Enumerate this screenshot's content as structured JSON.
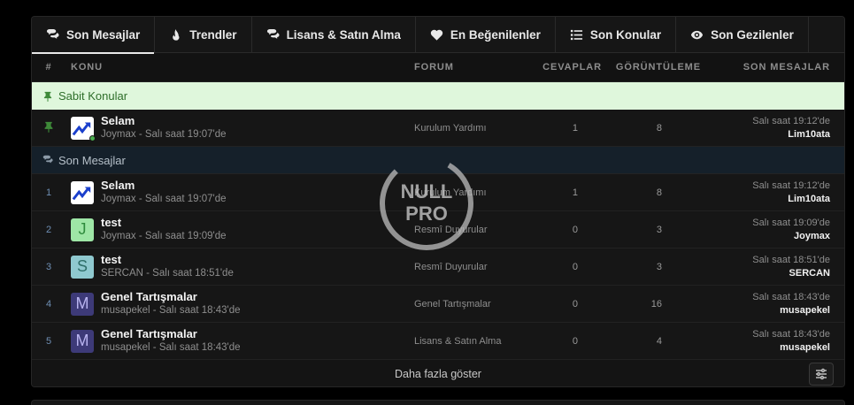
{
  "tabs": [
    {
      "label": "Son Mesajlar",
      "icon": "comments-icon"
    },
    {
      "label": "Trendler",
      "icon": "fire-icon"
    },
    {
      "label": "Lisans & Satın Alma",
      "icon": "comments-icon"
    },
    {
      "label": "En Beğenilenler",
      "icon": "heart-icon"
    },
    {
      "label": "Son Konular",
      "icon": "list-icon"
    },
    {
      "label": "Son Gezilenler",
      "icon": "eye-icon"
    }
  ],
  "columns": {
    "num": "#",
    "topic": "KONU",
    "forum": "FORUM",
    "replies": "CEVAPLAR",
    "views": "GÖRÜNTÜLEME",
    "last": "SON MESAJLAR"
  },
  "sticky_section": {
    "label": "Sabit Konular",
    "icon": "pin-icon"
  },
  "sticky_rows": [
    {
      "title": "Selam",
      "meta": "Joymax - Salı saat 19:07'de",
      "forum": "Kurulum Yardımı",
      "replies": "1",
      "views": "8",
      "last_time": "Salı saat 19:12'de",
      "last_user": "Lim10ata",
      "avatar_letter": "",
      "avatar_color": "#ffffff"
    }
  ],
  "recent_section": {
    "label": "Son Mesajlar",
    "icon": "comments-icon"
  },
  "rows": [
    {
      "num": "1",
      "title": "Selam",
      "meta": "Joymax - Salı saat 19:07'de",
      "forum": "Kurulum Yardımı",
      "replies": "1",
      "views": "8",
      "last_time": "Salı saat 19:12'de",
      "last_user": "Lim10ata",
      "avatar_letter": "",
      "avatar_color": "#ffffff"
    },
    {
      "num": "2",
      "title": "test",
      "meta": "Joymax - Salı saat 19:09'de",
      "forum": "Resmî Duyurular",
      "replies": "0",
      "views": "3",
      "last_time": "Salı saat 19:09'de",
      "last_user": "Joymax",
      "avatar_letter": "J",
      "avatar_color": "#9ee6a6"
    },
    {
      "num": "3",
      "title": "test",
      "meta": "SERCAN - Salı saat 18:51'de",
      "forum": "Resmî Duyurular",
      "replies": "0",
      "views": "3",
      "last_time": "Salı saat 18:51'de",
      "last_user": "SERCAN",
      "avatar_letter": "S",
      "avatar_color": "#8fc9cf"
    },
    {
      "num": "4",
      "title": "Genel Tartışmalar",
      "meta": "musapekel - Salı saat 18:43'de",
      "forum": "Genel Tartışmalar",
      "replies": "0",
      "views": "16",
      "last_time": "Salı saat 18:43'de",
      "last_user": "musapekel",
      "avatar_letter": "M",
      "avatar_color": "#3d3a78"
    },
    {
      "num": "5",
      "title": "Genel Tartışmalar",
      "meta": "musapekel - Salı saat 18:43'de",
      "forum": "Lisans & Satın Alma",
      "replies": "0",
      "views": "4",
      "last_time": "Salı saat 18:43'de",
      "last_user": "musapekel",
      "avatar_letter": "M",
      "avatar_color": "#3d3a78"
    }
  ],
  "footer": {
    "more_label": "Daha fazla göster",
    "filter_icon": "sliders-icon"
  },
  "watermark": {
    "line1": "NULL",
    "line2": "PRO"
  }
}
